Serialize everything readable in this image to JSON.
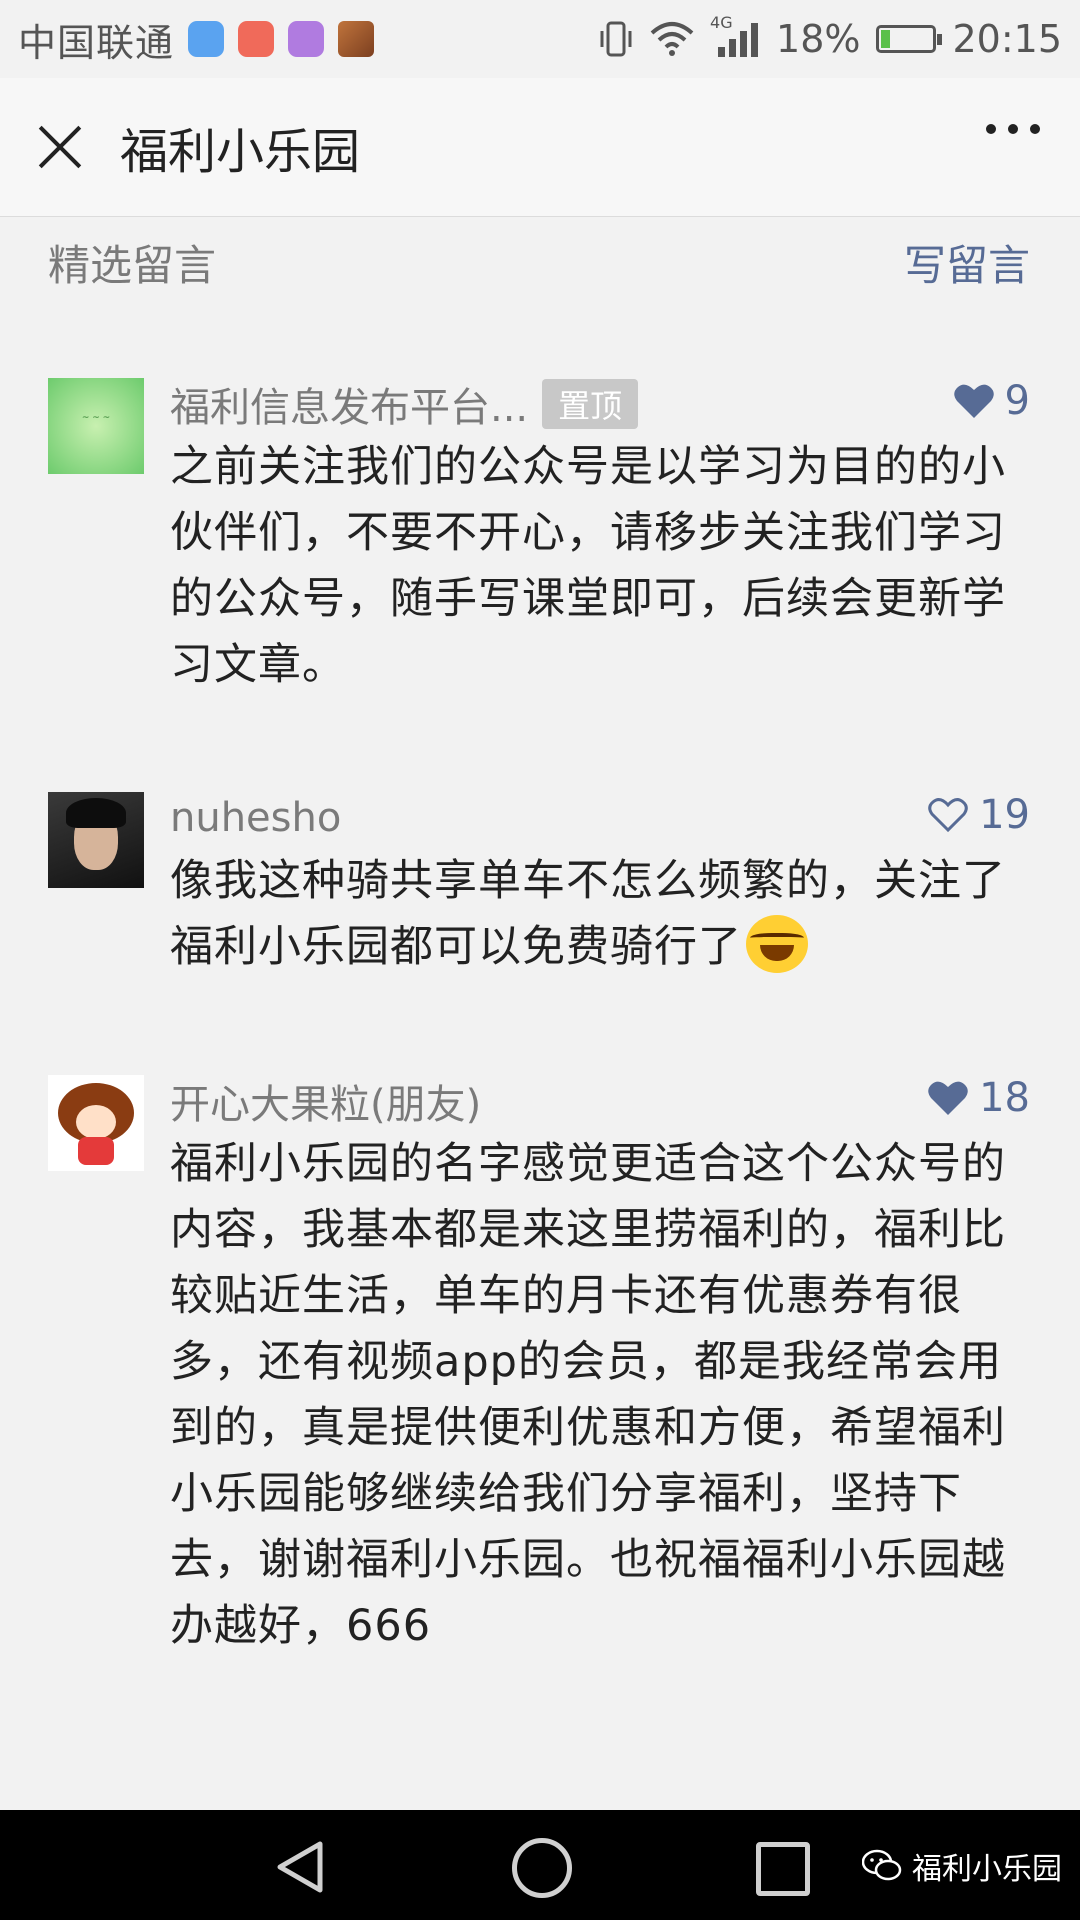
{
  "status_bar": {
    "carrier": "中国联通",
    "network": "4G",
    "battery": "18%",
    "battery_level": 0.18,
    "time": "20:15",
    "icons": [
      "location-app-icon",
      "health-app-icon",
      "gallery-app-icon",
      "user-avatar-icon",
      "vibrate-icon",
      "wifi-icon",
      "signal-icon",
      "battery-icon"
    ]
  },
  "header": {
    "title": "福利小乐园"
  },
  "section": {
    "title": "精选留言",
    "write_label": "写留言"
  },
  "comments": [
    {
      "nickname": "福利信息发布平台...",
      "badge": "置顶",
      "likes": "9",
      "liked": true,
      "text": "之前关注我们的公众号是以学习为目的的小伙伴们，不要不开心，请移步关注我们学习的公众号，随手写课堂即可，后续会更新学习文章。"
    },
    {
      "nickname": "nuhesho",
      "likes": "19",
      "liked": false,
      "text": "像我这种骑共享单车不怎么频繁的，关注了福利小乐园都可以免费骑行了"
    },
    {
      "nickname": "开心大果粒(朋友)",
      "likes": "18",
      "liked": true,
      "text": "福利小乐园的名字感觉更适合这个公众号的内容，我基本都是来这里捞福利的，福利比较贴近生活，单车的月卡还有优惠券有很多，还有视频app的会员，都是我经常会用到的，真是提供便利优惠和方便，希望福利小乐园能够继续给我们分享福利，坚持下去，谢谢福利小乐园。也祝福福利小乐园越办越好，666"
    }
  ],
  "watermark": {
    "text": "福利小乐园"
  },
  "colors": {
    "link": "#576b95",
    "background": "#f2f2f2",
    "muted": "#7a7a7a"
  }
}
